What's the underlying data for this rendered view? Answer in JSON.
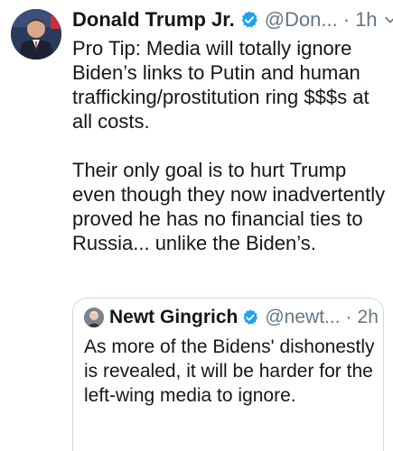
{
  "tweet": {
    "author_name": "Donald Trump Jr.",
    "author_handle": "@Don...",
    "separator": "·",
    "time": "1h",
    "text_paragraph_1": "Pro Tip: Media will totally ignore Biden’s links to Putin and human trafficking/prostitution ring $$$s at all costs.",
    "text_paragraph_2": "Their only goal is to hurt Trump even though they now inadvertently proved he has no financial ties to Russia... unlike the Biden’s."
  },
  "quoted_tweet": {
    "author_name": "Newt Gingrich",
    "author_handle": "@newt...",
    "separator": "·",
    "time": "2h",
    "text": "As more of the Bidens' dishonestly is revealed, it will be harder for the left-wing media to ignore."
  },
  "colors": {
    "verified_blue": "#1da1f2",
    "secondary_text": "#657786",
    "border": "#cfd9de"
  },
  "icons": {
    "verified": "verified-badge-icon",
    "more": "chevron-down-icon"
  }
}
